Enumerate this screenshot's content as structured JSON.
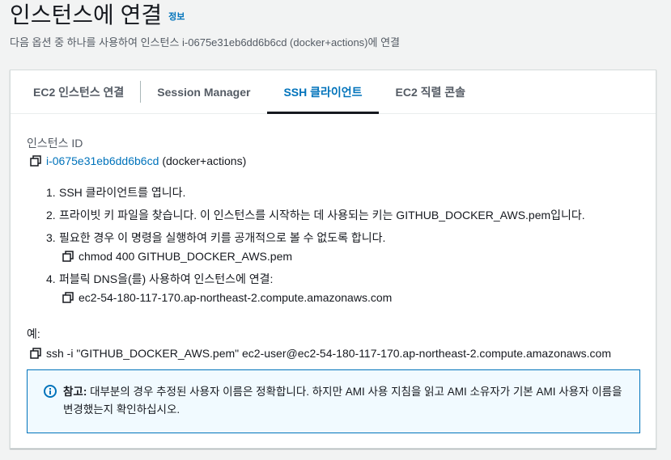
{
  "header": {
    "title": "인스턴스에 연결",
    "info_link": "정보",
    "description": "다음 옵션 중 하나를 사용하여 인스턴스 i-0675e31eb6dd6b6cd (docker+actions)에 연결"
  },
  "tabs": [
    {
      "label": "EC2 인스턴스 연결",
      "active": false
    },
    {
      "label": "Session Manager",
      "active": false
    },
    {
      "label": "SSH 클라이언트",
      "active": true
    },
    {
      "label": "EC2 직렬 콘솔",
      "active": false
    }
  ],
  "instance": {
    "label": "인스턴스 ID",
    "id": "i-0675e31eb6dd6b6cd",
    "name": "(docker+actions)"
  },
  "steps": [
    {
      "num": "1.",
      "text": "SSH 클라이언트를 엽니다."
    },
    {
      "num": "2.",
      "text": "프라이빗 키 파일을 찾습니다. 이 인스턴스를 시작하는 데 사용되는 키는 GITHUB_DOCKER_AWS.pem입니다."
    },
    {
      "num": "3.",
      "text": "필요한 경우 이 명령을 실행하여 키를 공개적으로 볼 수 없도록 합니다.",
      "command": "chmod 400 GITHUB_DOCKER_AWS.pem"
    },
    {
      "num": "4.",
      "text": "퍼블릭 DNS을(를) 사용하여 인스턴스에 연결:",
      "command": "ec2-54-180-117-170.ap-northeast-2.compute.amazonaws.com"
    }
  ],
  "example": {
    "label": "예:",
    "command": "ssh -i \"GITHUB_DOCKER_AWS.pem\" ec2-user@ec2-54-180-117-170.ap-northeast-2.compute.amazonaws.com"
  },
  "note": {
    "bold": "참고:",
    "text": " 대부분의 경우 추정된 사용자 이름은 정확합니다. 하지만 AMI 사용 지침을 읽고 AMI 소유자가 기본 AMI 사용자 이름을 변경했는지 확인하십시오."
  },
  "colors": {
    "link": "#0073bb",
    "alert_border": "#0073bb",
    "alert_bg": "#f1faff"
  }
}
